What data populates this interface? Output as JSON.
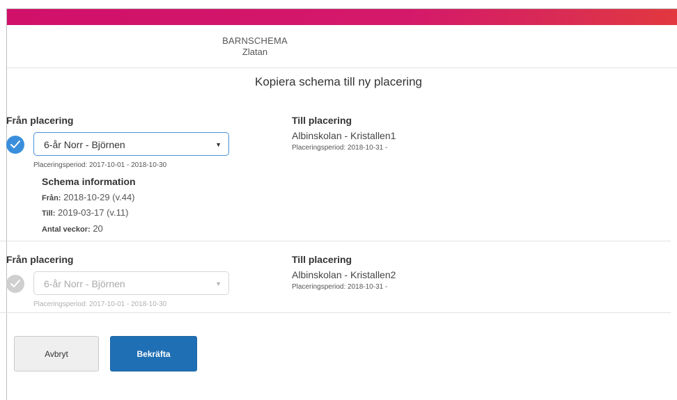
{
  "header": {
    "app_title": "BARNSCHEMA",
    "child_name": "Zlatan",
    "brand_gradient": [
      "#d1106a",
      "#e2383e"
    ]
  },
  "dialog": {
    "title": "Kopiera schema till ny placering"
  },
  "placements": [
    {
      "from_label": "Från placering",
      "checked": true,
      "enabled": true,
      "check_icon": "checkmark-icon",
      "selected_value": "6-år Norr - Björnen",
      "period": "Placeringsperiod: 2017-10-01 - 2018-10-30",
      "schema": {
        "title": "Schema information",
        "from_key": "Från:",
        "from_value": "2018-10-29 (v.44)",
        "to_key": "Till:",
        "to_value": "2019-03-17 (v.11)",
        "weeks_key": "Antal veckor:",
        "weeks_value": "20"
      },
      "to_label": "Till placering",
      "to_value": "Albinskolan - Kristallen1",
      "to_period": "Placeringsperiod: 2018-10-31 -"
    },
    {
      "from_label": "Från placering",
      "checked": false,
      "enabled": false,
      "check_icon": "checkmark-icon",
      "selected_value": "6-år Norr - Björnen",
      "period": "Placeringsperiod: 2017-10-01 - 2018-10-30",
      "to_label": "Till placering",
      "to_value": "Albinskolan - Kristallen2",
      "to_period": "Placeringsperiod: 2018-10-31 -"
    }
  ],
  "actions": {
    "cancel_label": "Avbryt",
    "confirm_label": "Bekräfta",
    "confirm_color": "#1f6fb5"
  }
}
